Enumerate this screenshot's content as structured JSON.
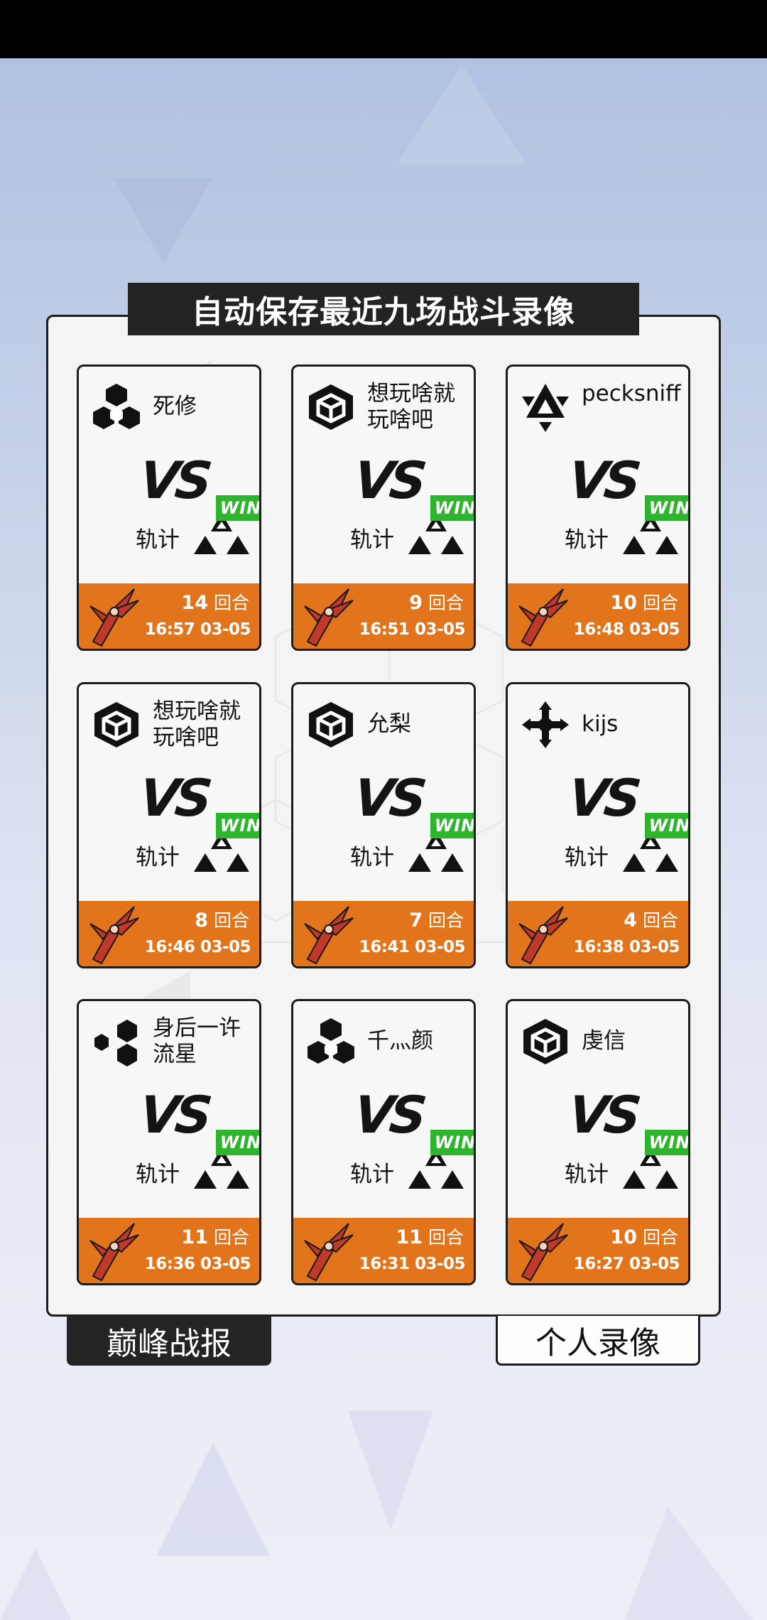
{
  "title": "自动保存最近九场战斗录像",
  "vs_text": "VS",
  "win_text": "WIN",
  "rounds_label": "回合",
  "player_name": "轨计",
  "records": [
    {
      "opponent": "死修",
      "opponent_icon": "hex-cluster-icon",
      "rounds": "14",
      "time": "16:57 03-05"
    },
    {
      "opponent": "想玩啥就玩啥吧",
      "opponent_icon": "cube-icon",
      "rounds": "9",
      "time": "16:51 03-05"
    },
    {
      "opponent": "pecksniff",
      "opponent_icon": "triangle-emblem-icon",
      "rounds": "10",
      "time": "16:48 03-05"
    },
    {
      "opponent": "想玩啥就玩啥吧",
      "opponent_icon": "cube-icon",
      "rounds": "8",
      "time": "16:46 03-05"
    },
    {
      "opponent": "允梨",
      "opponent_icon": "cube-icon",
      "rounds": "7",
      "time": "16:41 03-05"
    },
    {
      "opponent": "kijs",
      "opponent_icon": "cross-arrows-icon",
      "rounds": "4",
      "time": "16:38 03-05"
    },
    {
      "opponent": "身后一许流星",
      "opponent_icon": "hex-arc-icon",
      "rounds": "11",
      "time": "16:36 03-05"
    },
    {
      "opponent": "千灬颜",
      "opponent_icon": "hex-cluster-icon",
      "rounds": "11",
      "time": "16:31 03-05"
    },
    {
      "opponent": "虔信",
      "opponent_icon": "cube-icon",
      "rounds": "10",
      "time": "16:27 03-05"
    }
  ],
  "tabs": {
    "left": "巅峰战报",
    "right": "个人录像"
  },
  "colors": {
    "accent": "#e2741c",
    "win": "#2fb52d",
    "dark": "#232323"
  }
}
